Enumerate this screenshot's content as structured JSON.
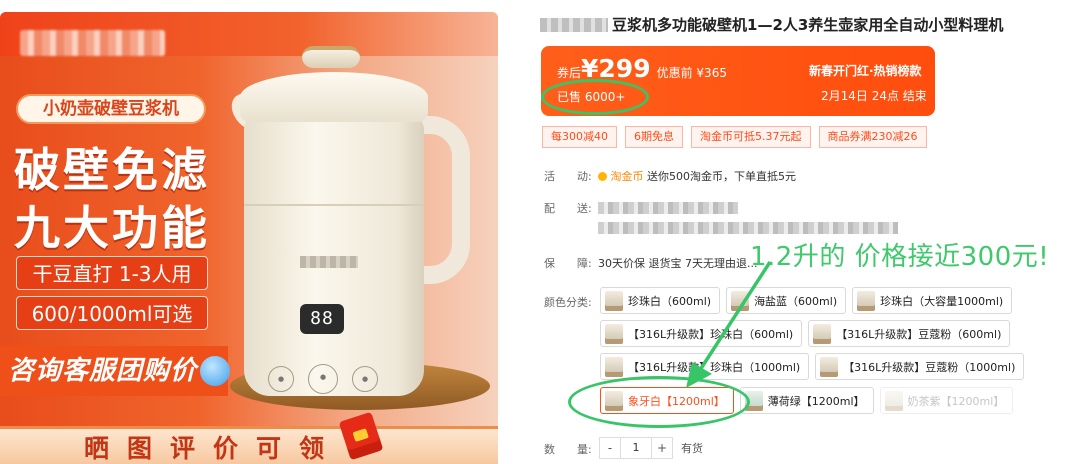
{
  "hero": {
    "slogan": "小奶壶破壁豆浆机",
    "headline_1": "破壁免滤",
    "headline_2": "九大功能",
    "feature_1": "干豆直打 1-3人用",
    "feature_2": "600/1000ml可选",
    "consult": "咨询客服团购价",
    "bottom_banner": "晒图评价可领",
    "display": "88",
    "accent_color": "#ef4f19"
  },
  "product": {
    "title": "豆浆机多功能破壁机1—2人3养生壶家用全自动小型料理机"
  },
  "price": {
    "coupon_label": "券后",
    "price": "¥299",
    "orig": "优惠前 ¥365",
    "sold": "已售 6000+",
    "promo_title": "新春开门红·热销榜款",
    "promo_time": "2月14日 24点 结束",
    "bg_color": "#ff5e1a"
  },
  "coupons": [
    "每300减40",
    "6期免息",
    "淘金币可抵5.37元起",
    "商品券满230减26"
  ],
  "details": {
    "activity_label": "活　　动:",
    "coin_name": "淘金币",
    "activity_text": "送你500淘金币，下单直抵5元",
    "delivery_label": "配　　送:",
    "guarantee_label": "保　　障:",
    "guarantee_text": "30天价保 退货宝 7天无理由退...",
    "color_label": "颜色分类:",
    "qty_label": "数　　量:",
    "qty_value": "1",
    "stock": "有货"
  },
  "swatches": [
    [
      "珍珠白（600ml)",
      "海盐蓝（600ml)",
      "珍珠白（大容量1000ml)"
    ],
    [
      "【316L升级款】珍珠白（600ml)",
      "【316L升级款】豆蔻粉（600ml)"
    ],
    [
      "【316L升级款】珍珠白（1000ml)",
      "【316L升级款】豆蔻粉（1000ml)"
    ],
    [
      "象牙白【1200ml】",
      "薄荷绿【1200ml】",
      "奶茶紫【1200ml】"
    ]
  ],
  "annotation": {
    "text": "1.2升的 价格接近300元!",
    "color": "#38c568"
  }
}
